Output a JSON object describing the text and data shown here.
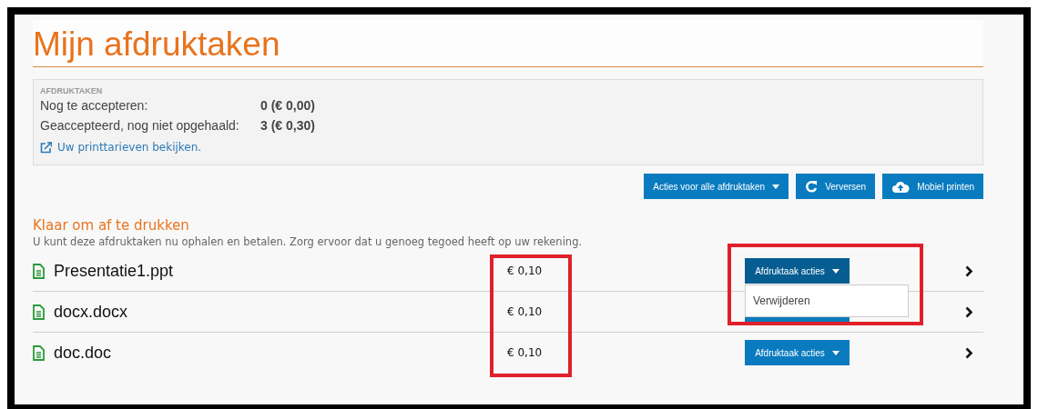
{
  "title": "Mijn afdruktaken",
  "summary": {
    "heading": "AFDRUKTAKEN",
    "lines": [
      {
        "label": "Nog te accepteren:",
        "value": "0 (€ 0,00)"
      },
      {
        "label": "Geaccepteerd, nog niet opgehaald:",
        "value": "3 (€ 0,30)"
      }
    ],
    "link": "Uw printtarieven bekijken."
  },
  "toolbar": [
    {
      "kind": "dropdown",
      "label": "Acties voor alle afdruktaken"
    },
    {
      "kind": "refresh",
      "label": "Verversen"
    },
    {
      "kind": "upload",
      "label": "Mobiel printen"
    }
  ],
  "section": {
    "heading": "Klaar om af te drukken",
    "description": "U kunt deze afdruktaken nu ophalen en betalen. Zorg ervoor dat u genoeg tegoed heeft op uw rekening."
  },
  "jobs": [
    {
      "name": "Presentatie1.ppt",
      "price": "€ 0,10",
      "action": "Afdruktaak acties",
      "expanded": true,
      "menu": [
        "Verwijderen"
      ]
    },
    {
      "name": "docx.docx",
      "price": "€ 0,10",
      "expanded": false
    },
    {
      "name": "doc.doc",
      "price": "€ 0,10",
      "action": "Afdruktaak acties",
      "expanded": false
    }
  ]
}
